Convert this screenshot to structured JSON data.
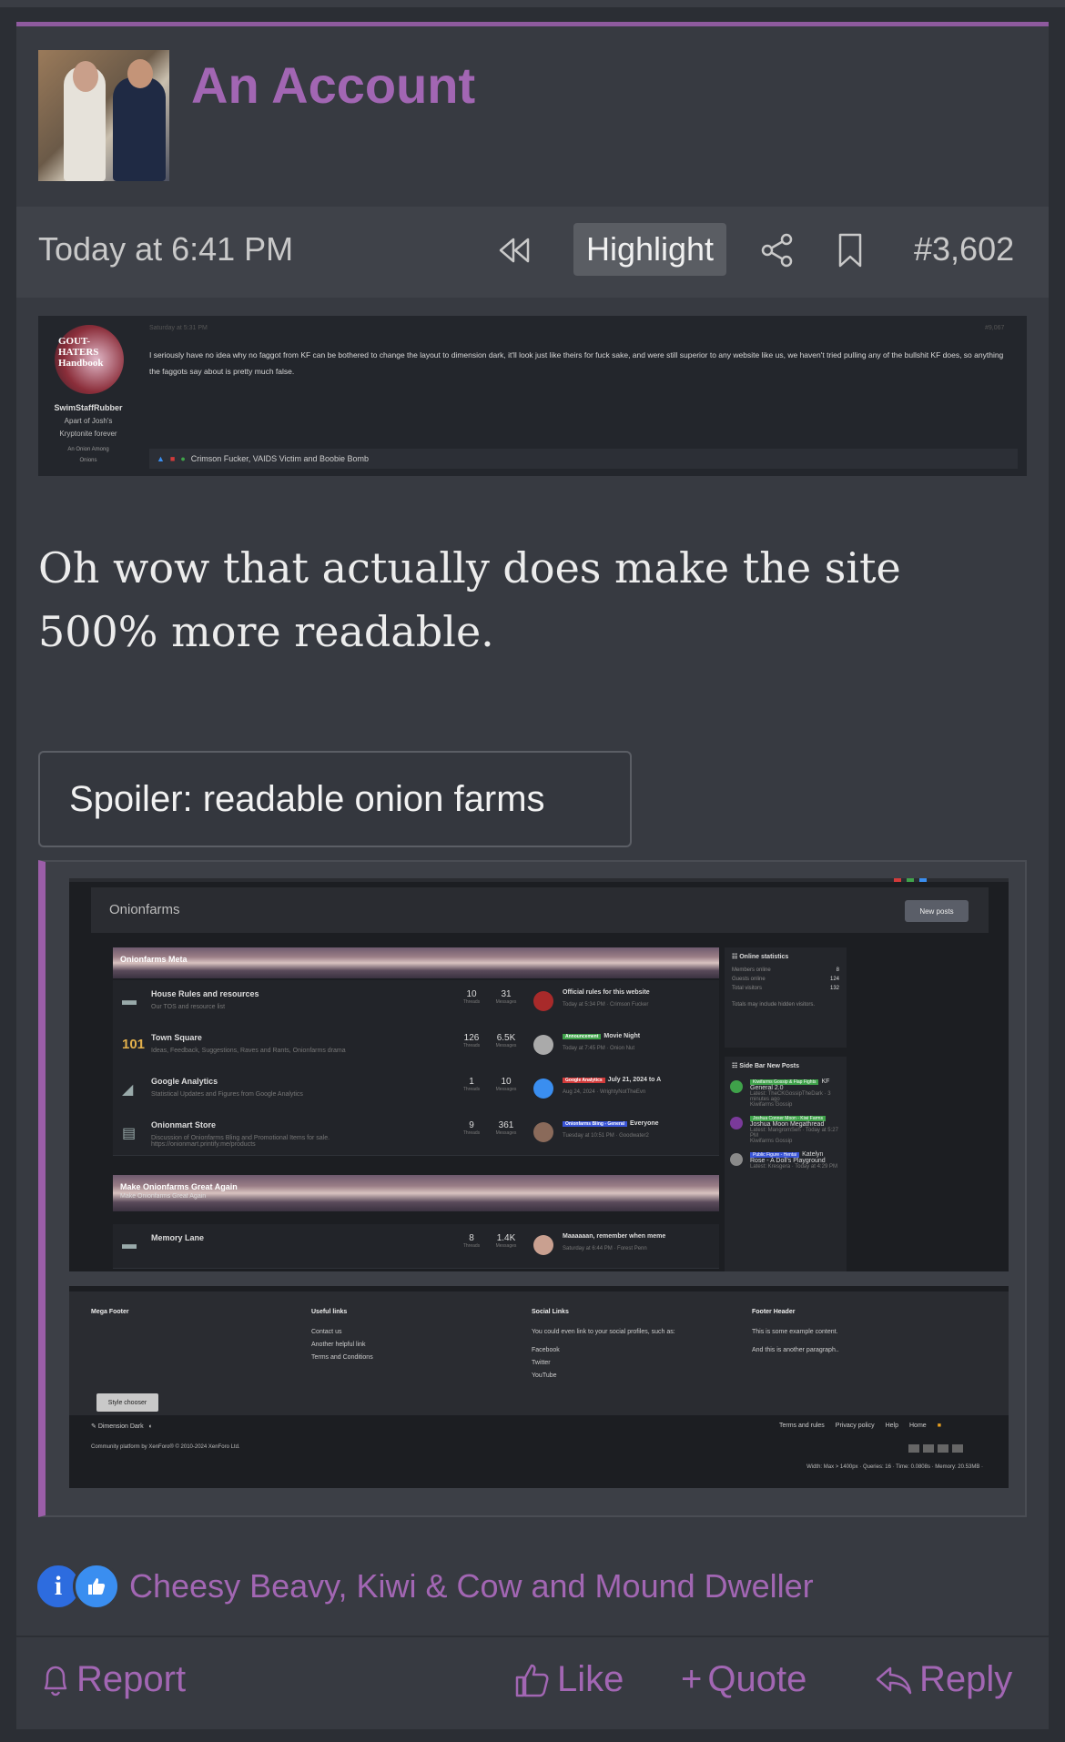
{
  "post": {
    "username": "An Account",
    "date": "Today at 6:41 PM",
    "highlight_label": "Highlight",
    "post_number": "#3,602",
    "icons": [
      "rewind-icon",
      "share-icon",
      "bookmark-icon"
    ],
    "message": "Oh wow that actually does make the site 500% more readable.",
    "spoiler_label": "Spoiler: readable onion farms",
    "reactions": {
      "icons": [
        "informative-icon",
        "like-icon"
      ],
      "names": "Cheesy Beavy, Kiwi & Cow and Mound Dweller"
    },
    "actions": {
      "report": "Report",
      "like": "Like",
      "quote": "Quote",
      "reply": "Reply"
    }
  },
  "quoted_screenshot": {
    "avatar_text": "GOUT-HATERS Handbook",
    "date": "Saturday at 5:31 PM",
    "post_number": "#9,067",
    "user": "SwimStaffRubber",
    "user_title_1": "Apart of Josh's",
    "user_title_2": "Kryptonite forever",
    "banner_1": "An Onion Among",
    "banner_2": "Onions",
    "text": "I seriously have no idea why no faggot from KF can be bothered to change the layout to dimension dark, it'll look just like theirs for fuck sake, and were still superior to any website like us, we haven't tried pulling any of the bullshit KF does, so anything the faggots say about is pretty much false.",
    "reactors": "Crimson Fucker, VAIDS Victim and Boobie Bomb"
  },
  "onionfarms_shot": {
    "site_title": "Onionfarms",
    "new_posts": "New posts",
    "section_1": "Onionfarms Meta",
    "section_2": "Make Onionfarms Great Again",
    "section_2_sub": "Make Onionfarms Great Again",
    "forums": [
      {
        "name": "House Rules and resources",
        "desc": "Our TOS and resource list",
        "threads": "10",
        "messages": "31",
        "last_title": "Official rules for this website",
        "last_sub": "Today at 5:34 PM · Crimson Fucker",
        "tag": "",
        "tag_color": ""
      },
      {
        "name": "Town Square",
        "desc": "Ideas, Feedback, Suggestions, Raves and Rants, Onionfarms drama",
        "threads": "126",
        "messages": "6.5K",
        "last_title": "Movie Night",
        "last_sub": "Today at 7:45 PM · Onion Nut",
        "tag": "Announcement",
        "tag_color": "#3fa24a"
      },
      {
        "name": "Google Analytics",
        "desc": "Statistical Updates and Figures from Google Analytics",
        "threads": "1",
        "messages": "10",
        "last_title": "July 21, 2024 to A",
        "last_sub": "Aug 24, 2024 · WrightyNotTheEvn",
        "tag": "Google Analytics",
        "tag_color": "#d23a3a"
      },
      {
        "name": "Onionmart Store",
        "desc": "Discussion of Onionfarms Bling and Promotional Items for sale. https://onionmart.printify.me/products",
        "threads": "9",
        "messages": "361",
        "last_title": "Everyone",
        "last_sub": "Tuesday at 10:51 PM · Goodwater2",
        "tag": "Onionfarms Bling - General",
        "tag_color": "#3a55d8"
      },
      {
        "name": "Memory Lane",
        "desc": "",
        "threads": "8",
        "messages": "1.4K",
        "last_title": "Maaaaaan, remember when meme",
        "last_sub": "Saturday at 6:44 PM · Forest Penn",
        "tag": "",
        "tag_color": ""
      }
    ],
    "threads_label": "Threads",
    "messages_label": "Messages",
    "stats": {
      "heading": "Online statistics",
      "members_label": "Members online",
      "members": "8",
      "guests_label": "Guests online",
      "guests": "124",
      "total_label": "Total visitors",
      "total": "132",
      "note": "Totals may include hidden visitors."
    },
    "sidebar_heading": "Side Bar New Posts",
    "sidebar_posts": [
      {
        "tag": "Kiwifarms Gossip & Flap Fights",
        "title": "KF General 2.0",
        "sub": "Latest: TheCKGossipTheDark · 3 minutes ago",
        "forum": "Kiwifarms Gossip"
      },
      {
        "tag": "Joshua Conner Moon - Kiwi Farms",
        "title": "Joshua Moon Megathread",
        "sub": "Latest: MangromSeh · Today at 5:27 PM",
        "forum": "Kiwifarms Gossip"
      },
      {
        "tag": "Public Figure - Hentai",
        "title": "Katelyn Rose - A Doll's Playground",
        "sub": "Latest: Kresgera · Today at 4:29 PM",
        "forum": ""
      }
    ]
  },
  "footer_shot": {
    "col1": "Mega Footer",
    "col2_head": "Useful links",
    "col2_items": [
      "Contact us",
      "Another helpful link",
      "Terms and Conditions"
    ],
    "col3_head": "Social Links",
    "col3_desc": "You could even link to your social profiles, such as:",
    "col3_items": [
      "Facebook",
      "Twitter",
      "YouTube"
    ],
    "col4_head": "Footer Header",
    "col4_items": [
      "This is some example content.",
      "And this is another paragraph.."
    ],
    "style_chooser": "Style chooser",
    "style_name": "Dimension Dark",
    "links": [
      "Terms and rules",
      "Privacy policy",
      "Help",
      "Home"
    ],
    "copyright": "Community platform by XenForo® © 2010-2024 XenForo Ltd.",
    "debug": "Width: Max > 1400px · Queries: 16 · Time: 0.0808s · Memory: 20.53MB ·"
  }
}
